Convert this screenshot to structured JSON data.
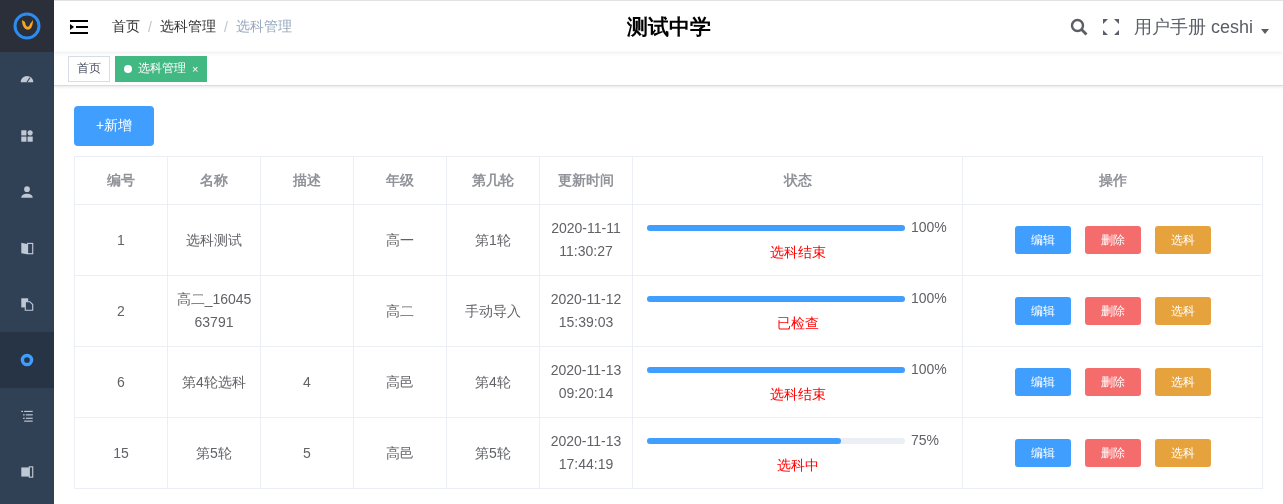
{
  "sidebar": {
    "items": [
      {
        "selected": false
      },
      {
        "selected": false
      },
      {
        "selected": false
      },
      {
        "selected": false
      },
      {
        "selected": false
      },
      {
        "selected": true
      },
      {
        "selected": false
      },
      {
        "selected": false
      }
    ]
  },
  "header": {
    "breadcrumb": [
      {
        "label": "首页",
        "current": false
      },
      {
        "label": "选科管理",
        "current": false
      },
      {
        "label": "选科管理",
        "current": true
      }
    ],
    "separator": "/",
    "title": "测试中学",
    "user": "用户手册 ceshi"
  },
  "tags": [
    {
      "label": "首页",
      "selected": false
    },
    {
      "label": "选科管理",
      "selected": true,
      "close": "×"
    }
  ],
  "add_button": "+新增",
  "table": {
    "columns": [
      "编号",
      "名称",
      "描述",
      "年级",
      "第几轮",
      "更新时间",
      "状态",
      "操作"
    ],
    "rows": [
      {
        "id": "1",
        "name": "选科测试",
        "desc": "",
        "grade": "高一",
        "round": "第1轮",
        "updated": [
          "2020-11-11",
          "11:30:27"
        ],
        "level": 1,
        "percent": "100%",
        "status": "选科结束",
        "actions": [
          {
            "label": "编辑",
            "kind": "edit"
          },
          {
            "label": "删除",
            "kind": "delete"
          },
          {
            "label": "选科",
            "kind": "select"
          }
        ]
      },
      {
        "id": "2",
        "name": "高二_1604563791",
        "desc": "",
        "grade": "高二",
        "round": "手动导入",
        "updated": [
          "2020-11-12",
          "15:39:03"
        ],
        "level": 1,
        "percent": "100%",
        "status": "已检查",
        "actions": [
          {
            "label": "编辑",
            "kind": "edit"
          },
          {
            "label": "删除",
            "kind": "delete"
          },
          {
            "label": "选科",
            "kind": "select"
          }
        ]
      },
      {
        "id": "6",
        "name": "第4轮选科",
        "desc": "4",
        "grade": "高邑",
        "round": "第4轮",
        "updated": [
          "2020-11-13",
          "09:20:14"
        ],
        "level": 1,
        "percent": "100%",
        "status": "选科结束",
        "actions": [
          {
            "label": "编辑",
            "kind": "edit"
          },
          {
            "label": "删除",
            "kind": "delete"
          },
          {
            "label": "选科",
            "kind": "select"
          }
        ]
      },
      {
        "id": "15",
        "name": "第5轮",
        "desc": "5",
        "grade": "高邑",
        "round": "第5轮",
        "updated": [
          "2020-11-13",
          "17:44:19"
        ],
        "level": 0.75,
        "percent": "75%",
        "status": "选科中",
        "actions": [
          {
            "label": "编辑",
            "kind": "edit"
          },
          {
            "label": "删除",
            "kind": "delete"
          },
          {
            "label": "选科",
            "kind": "select"
          }
        ]
      }
    ]
  }
}
